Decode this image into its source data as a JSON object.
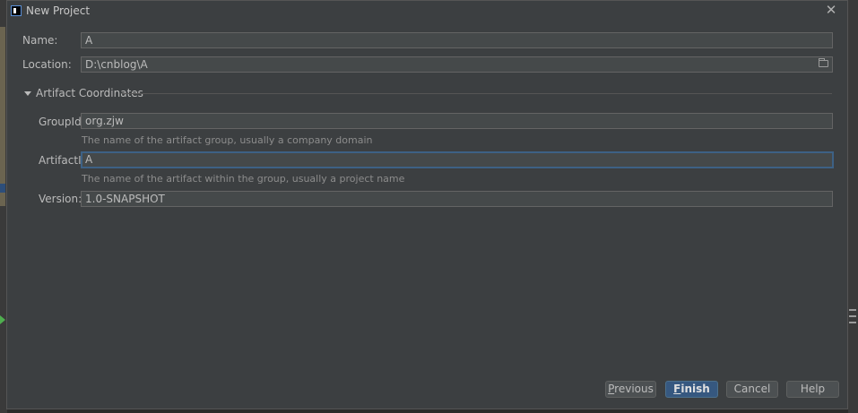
{
  "window": {
    "title": "New Project",
    "close_glyph": "✕"
  },
  "form": {
    "name_label": "Name:",
    "name_value": "A",
    "location_label": "Location:",
    "location_value": "D:\\cnblog\\A",
    "section_title": "Artifact Coordinates",
    "groupid_label": "GroupId:",
    "groupid_value": "org.zjw",
    "groupid_hint": "The name of the artifact group, usually a company domain",
    "artifactid_label": "ArtifactId:",
    "artifactid_value": "A",
    "artifactid_hint": "The name of the artifact within the group, usually a project name",
    "version_label": "Version:",
    "version_value": "1.0-SNAPSHOT"
  },
  "buttons": {
    "previous_mn": "P",
    "previous_rest": "revious",
    "finish_mn": "F",
    "finish_rest": "inish",
    "cancel": "Cancel",
    "help": "Help"
  },
  "colors": {
    "dialog_bg": "#3c3f41",
    "field_bg": "#45494a",
    "primary_button": "#365880",
    "focus_border": "#3d6185"
  },
  "icons": {
    "app": "intellij-icon",
    "close": "close-icon",
    "folder": "folder-icon",
    "expand": "triangle-down-icon"
  }
}
